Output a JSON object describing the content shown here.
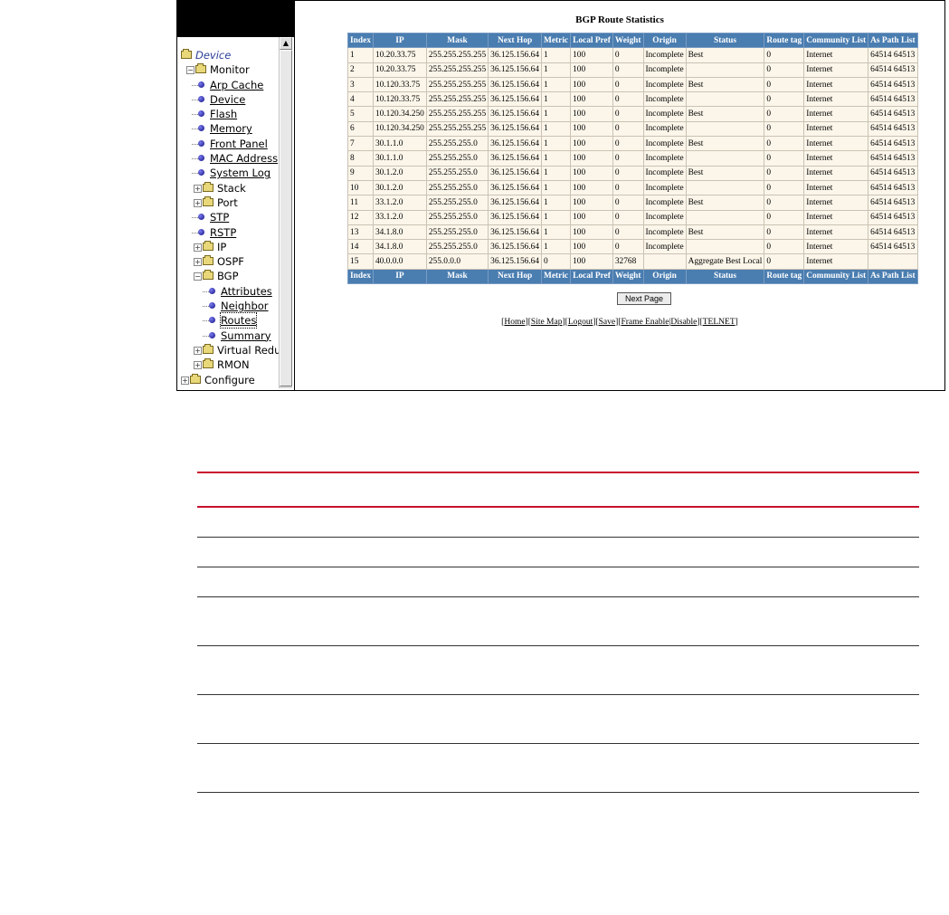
{
  "nav": {
    "tree": [
      {
        "label": "Device",
        "indent": 0,
        "kind": "root",
        "expander": ""
      },
      {
        "label": "Monitor",
        "indent": 1,
        "kind": "folder",
        "expander": "−"
      },
      {
        "label": "Arp Cache",
        "indent": 2,
        "kind": "leaf",
        "expander": ""
      },
      {
        "label": "Device",
        "indent": 2,
        "kind": "leaf",
        "expander": ""
      },
      {
        "label": "Flash",
        "indent": 2,
        "kind": "leaf",
        "expander": ""
      },
      {
        "label": "Memory",
        "indent": 2,
        "kind": "leaf",
        "expander": ""
      },
      {
        "label": "Front Panel",
        "indent": 2,
        "kind": "leaf",
        "expander": ""
      },
      {
        "label": "MAC Address",
        "indent": 2,
        "kind": "leaf",
        "expander": ""
      },
      {
        "label": "System Log",
        "indent": 2,
        "kind": "leaf",
        "expander": ""
      },
      {
        "label": "Stack",
        "indent": 2,
        "kind": "folder",
        "expander": "+"
      },
      {
        "label": "Port",
        "indent": 2,
        "kind": "folder",
        "expander": "+"
      },
      {
        "label": "STP",
        "indent": 2,
        "kind": "leaf",
        "expander": ""
      },
      {
        "label": "RSTP",
        "indent": 2,
        "kind": "leaf",
        "expander": ""
      },
      {
        "label": "IP",
        "indent": 2,
        "kind": "folder",
        "expander": "+"
      },
      {
        "label": "OSPF",
        "indent": 2,
        "kind": "folder",
        "expander": "+"
      },
      {
        "label": "BGP",
        "indent": 2,
        "kind": "folder",
        "expander": "−"
      },
      {
        "label": "Attributes",
        "indent": 3,
        "kind": "leaf",
        "expander": ""
      },
      {
        "label": "Neighbor",
        "indent": 3,
        "kind": "leaf",
        "expander": ""
      },
      {
        "label": "Routes",
        "indent": 3,
        "kind": "leaf",
        "expander": "",
        "selected": true
      },
      {
        "label": "Summary",
        "indent": 3,
        "kind": "leaf",
        "expander": ""
      },
      {
        "label": "Virtual Redundancy",
        "indent": 2,
        "kind": "folder",
        "expander": "+"
      },
      {
        "label": "RMON",
        "indent": 2,
        "kind": "folder",
        "expander": "+"
      },
      {
        "label": "Configure",
        "indent": 0,
        "kind": "folder",
        "expander": "+"
      }
    ],
    "scroll_up_glyph": "▲"
  },
  "table": {
    "title": "BGP Route Statistics",
    "columns": [
      "Index",
      "IP",
      "Mask",
      "Next Hop",
      "Metric",
      "Local Pref",
      "Weight",
      "Origin",
      "Status",
      "Route tag",
      "Community List",
      "As Path List"
    ],
    "rows": [
      [
        "1",
        "10.20.33.75",
        "255.255.255.255",
        "36.125.156.64",
        "1",
        "100",
        "0",
        "Incomplete",
        "Best",
        "0",
        "Internet",
        "64514 64513"
      ],
      [
        "2",
        "10.20.33.75",
        "255.255.255.255",
        "36.125.156.64",
        "1",
        "100",
        "0",
        "Incomplete",
        "",
        "0",
        "Internet",
        "64514 64513"
      ],
      [
        "3",
        "10.120.33.75",
        "255.255.255.255",
        "36.125.156.64",
        "1",
        "100",
        "0",
        "Incomplete",
        "Best",
        "0",
        "Internet",
        "64514 64513"
      ],
      [
        "4",
        "10.120.33.75",
        "255.255.255.255",
        "36.125.156.64",
        "1",
        "100",
        "0",
        "Incomplete",
        "",
        "0",
        "Internet",
        "64514 64513"
      ],
      [
        "5",
        "10.120.34.250",
        "255.255.255.255",
        "36.125.156.64",
        "1",
        "100",
        "0",
        "Incomplete",
        "Best",
        "0",
        "Internet",
        "64514 64513"
      ],
      [
        "6",
        "10.120.34.250",
        "255.255.255.255",
        "36.125.156.64",
        "1",
        "100",
        "0",
        "Incomplete",
        "",
        "0",
        "Internet",
        "64514 64513"
      ],
      [
        "7",
        "30.1.1.0",
        "255.255.255.0",
        "36.125.156.64",
        "1",
        "100",
        "0",
        "Incomplete",
        "Best",
        "0",
        "Internet",
        "64514 64513"
      ],
      [
        "8",
        "30.1.1.0",
        "255.255.255.0",
        "36.125.156.64",
        "1",
        "100",
        "0",
        "Incomplete",
        "",
        "0",
        "Internet",
        "64514 64513"
      ],
      [
        "9",
        "30.1.2.0",
        "255.255.255.0",
        "36.125.156.64",
        "1",
        "100",
        "0",
        "Incomplete",
        "Best",
        "0",
        "Internet",
        "64514 64513"
      ],
      [
        "10",
        "30.1.2.0",
        "255.255.255.0",
        "36.125.156.64",
        "1",
        "100",
        "0",
        "Incomplete",
        "",
        "0",
        "Internet",
        "64514 64513"
      ],
      [
        "11",
        "33.1.2.0",
        "255.255.255.0",
        "36.125.156.64",
        "1",
        "100",
        "0",
        "Incomplete",
        "Best",
        "0",
        "Internet",
        "64514 64513"
      ],
      [
        "12",
        "33.1.2.0",
        "255.255.255.0",
        "36.125.156.64",
        "1",
        "100",
        "0",
        "Incomplete",
        "",
        "0",
        "Internet",
        "64514 64513"
      ],
      [
        "13",
        "34.1.8.0",
        "255.255.255.0",
        "36.125.156.64",
        "1",
        "100",
        "0",
        "Incomplete",
        "Best",
        "0",
        "Internet",
        "64514 64513"
      ],
      [
        "14",
        "34.1.8.0",
        "255.255.255.0",
        "36.125.156.64",
        "1",
        "100",
        "0",
        "Incomplete",
        "",
        "0",
        "Internet",
        "64514 64513"
      ],
      [
        "15",
        "40.0.0.0",
        "255.0.0.0",
        "36.125.156.64",
        "0",
        "100",
        "32768",
        "",
        "Aggregate Best Local",
        "0",
        "Internet",
        ""
      ]
    ]
  },
  "next_page_label": "Next Page",
  "footer_links": [
    "Home",
    "Site Map",
    "Logout",
    "Save",
    "Frame Enable",
    "Disable",
    "TELNET"
  ],
  "colors": {
    "header_bg": "#4a7db0",
    "cell_bg": "#fcf6ea",
    "rule_red": "#c8102e"
  }
}
